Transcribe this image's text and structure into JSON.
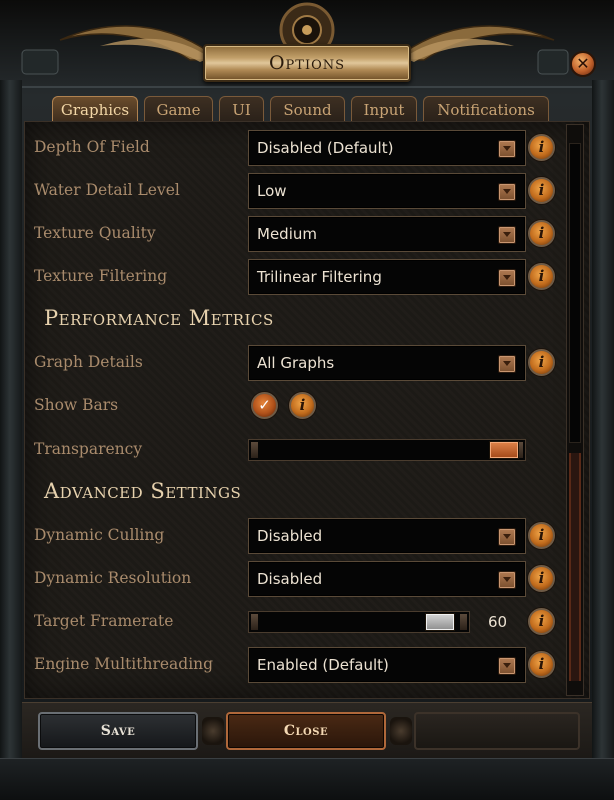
{
  "window": {
    "title": "Options",
    "close_glyph": "✕"
  },
  "tabs": [
    {
      "label": "Graphics",
      "active": true
    },
    {
      "label": "Game",
      "active": false
    },
    {
      "label": "UI",
      "active": false
    },
    {
      "label": "Sound",
      "active": false
    },
    {
      "label": "Input",
      "active": false
    },
    {
      "label": "Notifications",
      "active": false
    }
  ],
  "settings": {
    "depth_of_field": {
      "label": "Depth Of Field",
      "value": "Disabled (Default)"
    },
    "water_detail_level": {
      "label": "Water Detail Level",
      "value": "Low"
    },
    "texture_quality": {
      "label": "Texture Quality",
      "value": "Medium"
    },
    "texture_filtering": {
      "label": "Texture Filtering",
      "value": "Trilinear Filtering"
    }
  },
  "performance_metrics": {
    "title": "Performance Metrics",
    "graph_details": {
      "label": "Graph Details",
      "value": "All Graphs"
    },
    "show_bars": {
      "label": "Show Bars",
      "checked": true,
      "check_glyph": "✓"
    },
    "transparency": {
      "label": "Transparency",
      "level": 1.0
    }
  },
  "advanced_settings": {
    "title": "Advanced Settings",
    "dynamic_culling": {
      "label": "Dynamic Culling",
      "value": "Disabled"
    },
    "dynamic_resolution": {
      "label": "Dynamic Resolution",
      "value": "Disabled"
    },
    "target_framerate": {
      "label": "Target Framerate",
      "value": "60"
    },
    "engine_multithreading": {
      "label": "Engine Multithreading",
      "value": "Enabled (Default)"
    }
  },
  "info_glyph": "i",
  "footer": {
    "save_label": "Save",
    "close_label": "Close"
  },
  "colors": {
    "label_text": "#a98b6c",
    "section_title": "#e7d2ae",
    "accent_orange": "#c16b1c",
    "tab_active": "#6a4c2c"
  },
  "icons": {
    "dropdown": "chevron-down-icon",
    "info": "info-icon",
    "check": "checkmark-icon",
    "close": "close-icon"
  }
}
